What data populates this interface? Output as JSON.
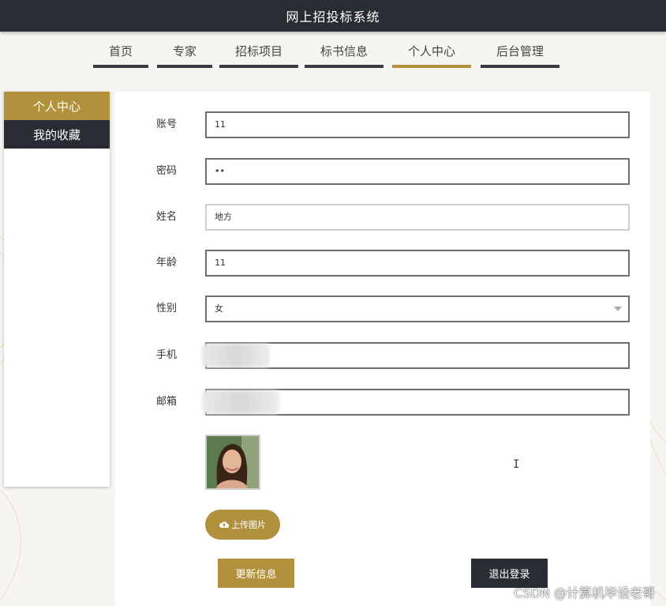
{
  "app": {
    "title": "网上招投标系统"
  },
  "nav": {
    "items": [
      {
        "label": "首页",
        "active": false
      },
      {
        "label": "专家",
        "active": false
      },
      {
        "label": "招标项目",
        "active": false
      },
      {
        "label": "标书信息",
        "active": false
      },
      {
        "label": "个人中心",
        "active": true
      },
      {
        "label": "后台管理",
        "active": false
      }
    ]
  },
  "sidebar": {
    "items": [
      {
        "label": "个人中心",
        "active": true
      },
      {
        "label": "我的收藏",
        "active": false
      }
    ]
  },
  "form": {
    "account": {
      "label": "账号",
      "value": "11"
    },
    "password": {
      "label": "密码",
      "value": "••"
    },
    "name": {
      "label": "姓名",
      "value": "地方"
    },
    "age": {
      "label": "年龄",
      "value": "11"
    },
    "gender": {
      "label": "性别",
      "value": "女"
    },
    "phone": {
      "label": "手机",
      "value": ""
    },
    "email": {
      "label": "邮箱",
      "value": ""
    }
  },
  "buttons": {
    "upload": "上传图片",
    "update": "更新信息",
    "logout": "退出登录"
  },
  "watermark": "CSDN @计算机毕设老哥",
  "colors": {
    "accent": "#b2913d",
    "dark": "#2a2c33"
  }
}
